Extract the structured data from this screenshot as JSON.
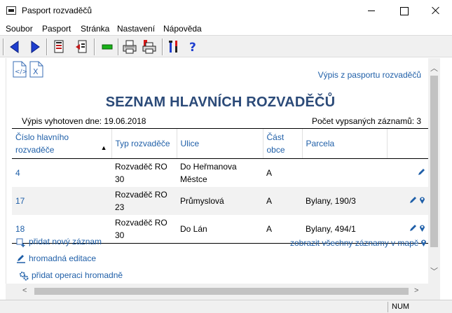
{
  "window": {
    "title": "Pasport rozvaděčů",
    "status_num": "NUM"
  },
  "menu": {
    "items": [
      "Soubor",
      "Pasport",
      "Stránka",
      "Nastavení",
      "Nápověda"
    ]
  },
  "toolbar": {
    "icons": [
      "back-arrow-icon",
      "forward-arrow-icon",
      "document-icon",
      "export-page-icon",
      "green-bar-icon",
      "print-icon",
      "print-red-icon",
      "tools-icon",
      "help-icon"
    ]
  },
  "report": {
    "link_text": "Výpis z pasportu rozvaděčů",
    "heading": "SEZNAM HLAVNÍCH ROZVADĚČŮ",
    "date_line": "Výpis vyhotoven dne: 19.06.2018",
    "count_line": "Počet vypsaných záznamů: 3"
  },
  "table": {
    "columns": [
      "Číslo hlavního rozvaděče",
      "Typ rozvaděče",
      "Ulice",
      "Část obce",
      "Parcela",
      ""
    ],
    "rows": [
      {
        "number": "4",
        "type": "Rozvaděč RO 30",
        "street": "Do Heřmanova Městce",
        "part": "A",
        "parcel": ""
      },
      {
        "number": "17",
        "type": "Rozvaděč RO 23",
        "street": "Průmyslová",
        "part": "A",
        "parcel": "Bylany, 190/3"
      },
      {
        "number": "18",
        "type": "Rozvaděč RO 30",
        "street": "Do Lán",
        "part": "A",
        "parcel": "Bylany, 494/1"
      }
    ]
  },
  "actions": {
    "add_record": "přidat nový záznam",
    "bulk_edit": "hromadná editace",
    "add_bulk_operation": "přidat operaci hromadně",
    "show_map": "zobrazit všechny záznamy v mapě"
  },
  "colors": {
    "link": "#1f5fa8",
    "heading": "#2b4a78",
    "row_alt": "#f2f2f2"
  }
}
